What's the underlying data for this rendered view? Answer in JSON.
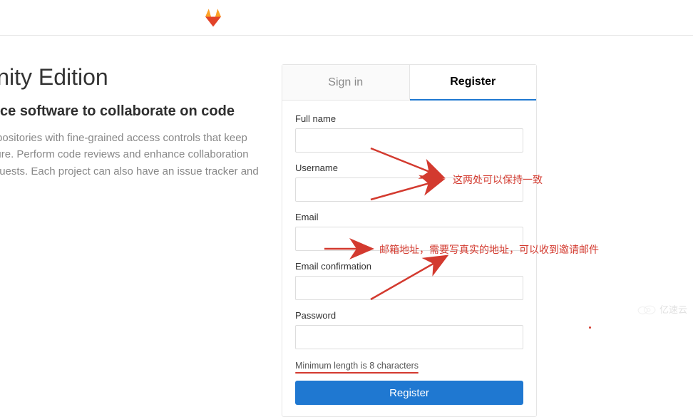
{
  "brand": {
    "name": "GitLab"
  },
  "marketing": {
    "title": "GitLab Community Edition",
    "subtitle": "Open source software to collaborate on code",
    "body": "Manage Git repositories with fine-grained access controls that keep your code secure. Perform code reviews and enhance collaboration with merge requests. Each project can also have an issue tracker and a wiki."
  },
  "tabs": {
    "signin": "Sign in",
    "register": "Register"
  },
  "form": {
    "fullname_label": "Full name",
    "username_label": "Username",
    "email_label": "Email",
    "email_confirm_label": "Email confirmation",
    "password_label": "Password",
    "password_hint": "Minimum length is 8 characters",
    "submit_label": "Register"
  },
  "annotations": {
    "same_hint": "这两处可以保持一致",
    "email_hint": "邮箱地址，需要写真实的地址，可以收到邀请邮件"
  },
  "watermark": {
    "text": "亿速云"
  }
}
